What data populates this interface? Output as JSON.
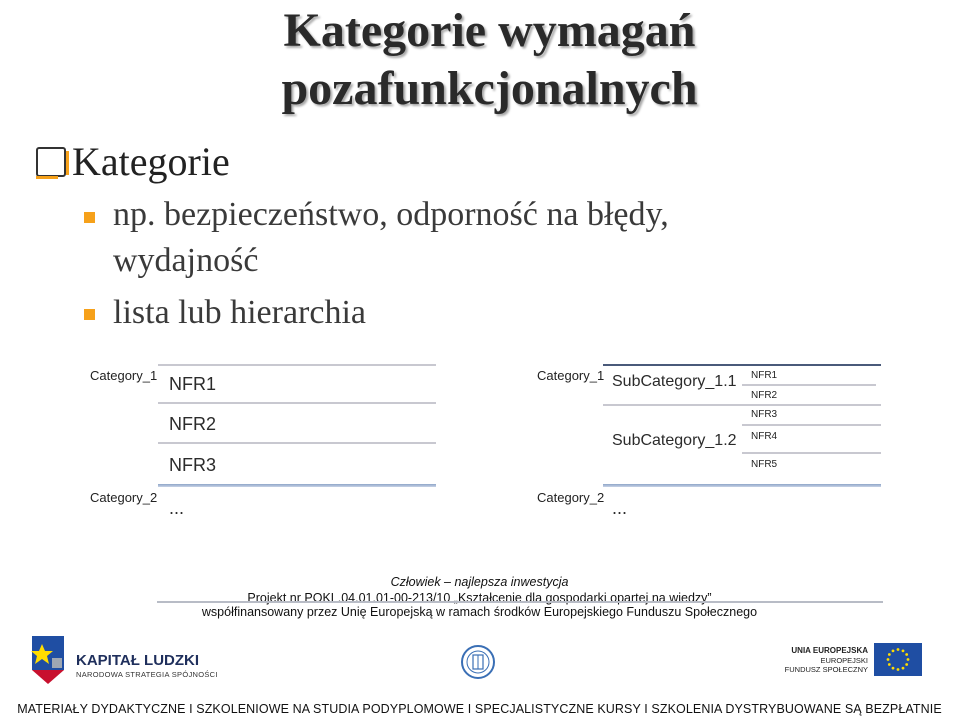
{
  "title": {
    "line1": "Kategorie wymagań",
    "line2": "pozafunkcjonalnych"
  },
  "bullets": {
    "level1": "Kategorie",
    "level2": [
      {
        "text": "np. bezpieczeństwo, odporność na błędy,",
        "cont": "wydajność"
      },
      {
        "text": "lista lub hierarchia"
      }
    ]
  },
  "list_diagram": {
    "categories": [
      "Category_1",
      "Category_2"
    ],
    "items": [
      "NFR1",
      "NFR2",
      "NFR3"
    ],
    "ellipsis": "..."
  },
  "hierarchy_diagram": {
    "categories": [
      "Category_1",
      "Category_2"
    ],
    "subcategories": [
      "SubCategory_1.1",
      "SubCategory_1.2"
    ],
    "items": [
      "NFR1",
      "NFR2",
      "NFR3",
      "NFR4",
      "NFR5"
    ],
    "ellipsis": "..."
  },
  "project": {
    "slogan": "Człowiek – najlepsza inwestycja",
    "line2": "Projekt nr POKL.04.01.01-00-213/10 „Kształcenie dla gospodarki opartej na wiedzy”",
    "line3": "współfinansowany przez Unię Europejską w ramach środków Europejskiego Funduszu Społecznego"
  },
  "logos": {
    "kl_title": "KAPITAŁ LUDZKI",
    "kl_sub": "NARODOWA STRATEGIA SPÓJNOŚCI",
    "ue_title": "UNIA EUROPEJSKA",
    "ue_sub1": "EUROPEJSKI",
    "ue_sub2": "FUNDUSZ SPOŁECZNY"
  },
  "footer": "MATERIAŁY DYDAKTYCZNE I SZKOLENIOWE NA STUDIA PODYPLOMOWE I SPECJALISTYCZNE KURSY I SZKOLENIA DYSTRYBUOWANE SĄ BEZPŁATNIE",
  "colors": {
    "bullet": "#f6a11a",
    "eu_blue": "#1f4ea3",
    "eu_star": "#ffdd00"
  }
}
